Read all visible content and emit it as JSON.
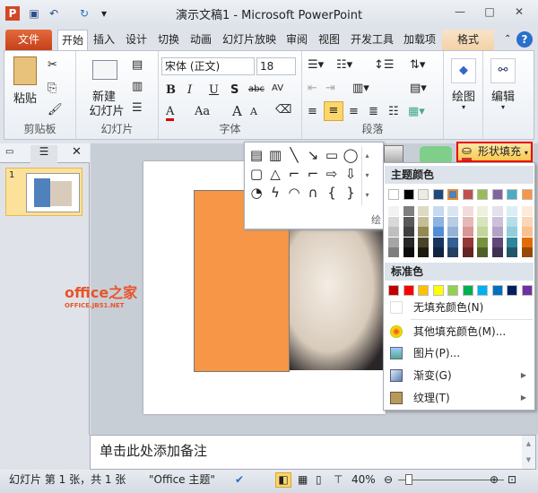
{
  "window": {
    "title": "演示文稿1 - Microsoft PowerPoint"
  },
  "tabs": {
    "file": "文件",
    "items": [
      "开始",
      "插入",
      "设计",
      "切换",
      "动画",
      "幻灯片放映",
      "审阅",
      "视图",
      "开发工具",
      "加载项"
    ],
    "format": "格式"
  },
  "ribbon": {
    "clipboard": {
      "paste": "粘贴",
      "label": "剪贴板"
    },
    "slides": {
      "new_slide_1": "新建",
      "new_slide_2": "幻灯片",
      "label": "幻灯片"
    },
    "font": {
      "font_name": "宋体 (正文)",
      "font_size": "18",
      "bold": "B",
      "italic": "I",
      "underline": "U",
      "shadow": "S",
      "strike": "abc",
      "spacing": "AV",
      "color": "A",
      "case": "Aa",
      "grow": "A",
      "shrink": "A",
      "label": "字体"
    },
    "paragraph": {
      "label": "段落"
    },
    "drawing": {
      "label": "绘图",
      "partial_label": "绘"
    },
    "editing": {
      "label": "编辑"
    }
  },
  "shape_fill": {
    "label": "形状填充"
  },
  "fill_menu": {
    "theme_colors_header": "主题颜色",
    "theme_colors": [
      "#ffffff",
      "#000000",
      "#eeece1",
      "#1f497d",
      "#4f81bd",
      "#c0504d",
      "#9bbb59",
      "#8064a2",
      "#4bacc6",
      "#f79646"
    ],
    "theme_tints": [
      [
        "#f2f2f2",
        "#7f7f7f",
        "#ddd9c3",
        "#c6d9f0",
        "#dbe5f1",
        "#f2dcdb",
        "#ebf1dd",
        "#e5e0ec",
        "#dbeef3",
        "#fdeada"
      ],
      [
        "#d8d8d8",
        "#595959",
        "#c4bd97",
        "#8db3e2",
        "#b8cce4",
        "#e5b9b7",
        "#d7e3bc",
        "#ccc1d9",
        "#b7dde8",
        "#fbd5b5"
      ],
      [
        "#bfbfbf",
        "#3f3f3f",
        "#938953",
        "#548dd4",
        "#95b3d7",
        "#d99694",
        "#c3d69b",
        "#b2a2c7",
        "#92cddc",
        "#fac08f"
      ],
      [
        "#a5a5a5",
        "#262626",
        "#494429",
        "#17365d",
        "#366092",
        "#953734",
        "#76923c",
        "#5f497a",
        "#31859b",
        "#e36c09"
      ],
      [
        "#7f7f7f",
        "#0c0c0c",
        "#1d1b10",
        "#0f243e",
        "#244061",
        "#632423",
        "#4f6128",
        "#3f3151",
        "#205867",
        "#974806"
      ]
    ],
    "standard_colors_header": "标准色",
    "standard_colors": [
      "#c00000",
      "#ff0000",
      "#ffc000",
      "#ffff00",
      "#92d050",
      "#00b050",
      "#00b0f0",
      "#0070c0",
      "#002060",
      "#7030a0"
    ],
    "no_fill": "无填充颜色(N)",
    "more_colors": "其他填充颜色(M)...",
    "picture": "图片(P)...",
    "gradient": "渐变(G)",
    "texture": "纹理(T)"
  },
  "slide_panel": {
    "slide_number": "1"
  },
  "notes": {
    "placeholder": "单击此处添加备注"
  },
  "status": {
    "slide_info": "幻灯片 第 1 张，共 1 张",
    "theme": "\"Office 主题\"",
    "zoom": "40%"
  },
  "watermark": {
    "text": "office之家",
    "sub": "OFFICE.JB51.NET"
  }
}
